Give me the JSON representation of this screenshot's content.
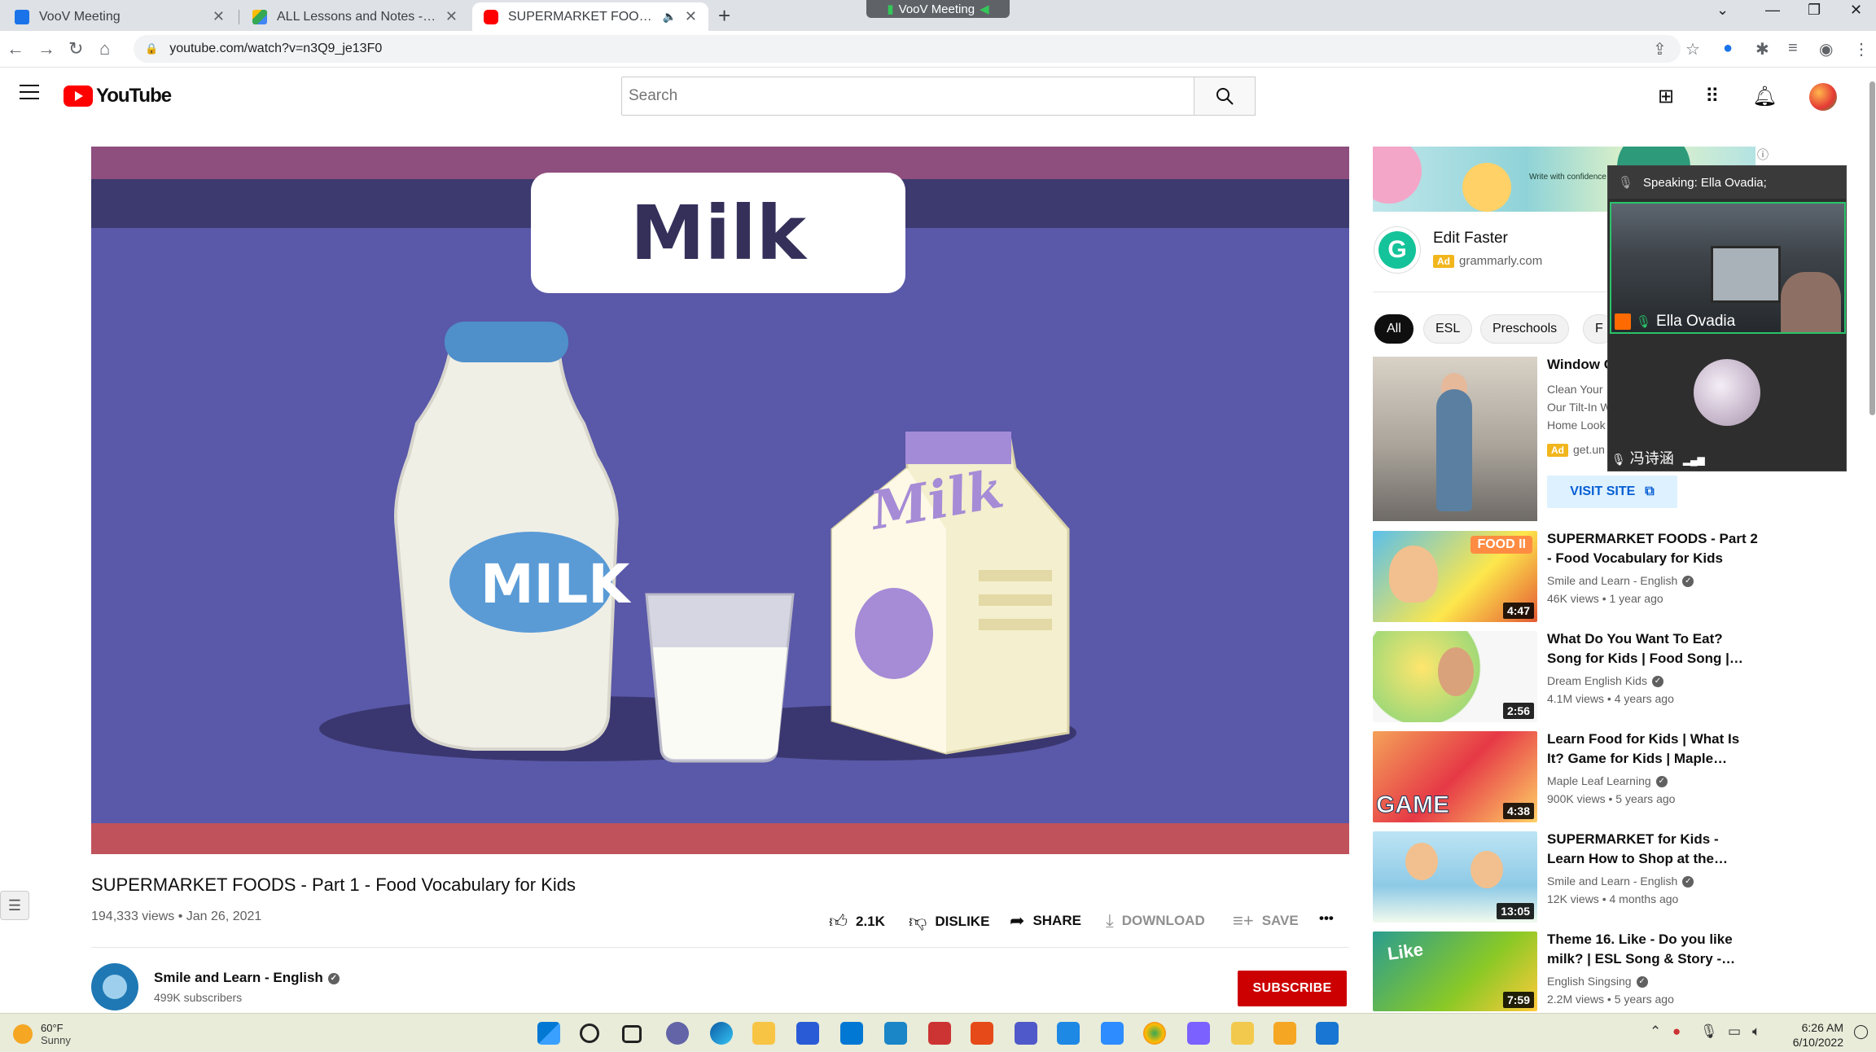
{
  "browser": {
    "tabs": [
      {
        "title": "VooV Meeting",
        "active": false
      },
      {
        "title": "ALL Lessons and Notes - Google",
        "active": false
      },
      {
        "title": "SUPERMARKET FOODS - Par",
        "active": true
      }
    ],
    "new_tab": "+",
    "meeting_pill": "VooV Meeting",
    "url": "youtube.com/watch?v=n3Q9_je13F0"
  },
  "youtube": {
    "logo_text": "YouTube",
    "search_placeholder": "Search"
  },
  "video": {
    "player_title_card": "Milk",
    "title": "SUPERMARKET FOODS - Part 1 - Food Vocabulary for Kids",
    "meta": "194,333 views • Jan 26, 2021",
    "actions": {
      "like_count": "2.1K",
      "dislike": "DISLIKE",
      "share": "SHARE",
      "download": "DOWNLOAD",
      "save": "SAVE",
      "more": "•••"
    },
    "channel": {
      "name": "Smile and Learn - English",
      "subscribers": "499K subscribers",
      "subscribe_label": "SUBSCRIBE"
    }
  },
  "sidebar": {
    "ad": {
      "banner_caption": "Write with confidence",
      "title": "Edit Faster",
      "badge": "Ad",
      "domain": "grammarly.com",
      "icon_letter": "G"
    },
    "chips": [
      "All",
      "ESL",
      "Preschools",
      "F"
    ],
    "promoted": {
      "title": "Window C",
      "lines": [
        "Clean Your",
        "Our Tilt-In W",
        "Home Look"
      ],
      "badge": "Ad",
      "domain": "get.un",
      "visit": "VISIT SITE"
    },
    "videos": [
      {
        "title": "SUPERMARKET FOODS - Part 2 - Food Vocabulary for Kids",
        "channel": "Smile and Learn - English",
        "meta": "46K views • 1 year ago",
        "duration": "4:47",
        "thumb_tag": "FOOD II"
      },
      {
        "title": "What Do You Want To Eat? Song for Kids | Food Song | Learn…",
        "channel": "Dream English Kids",
        "meta": "4.1M views • 4 years ago",
        "duration": "2:56"
      },
      {
        "title": "Learn Food for Kids | What Is It? Game for Kids | Maple Leaf…",
        "channel": "Maple Leaf Learning",
        "meta": "900K views • 5 years ago",
        "duration": "4:38",
        "thumb_tag": "GAME"
      },
      {
        "title": "SUPERMARKET for Kids - Learn How to Shop at the…",
        "channel": "Smile and Learn - English",
        "meta": "12K views • 4 months ago",
        "duration": "13:05"
      },
      {
        "title": "Theme 16. Like - Do you like milk? | ESL Song & Story -…",
        "channel": "English Singsing",
        "meta": "2.2M views • 5 years ago",
        "duration": "7:59",
        "thumb_tag": "Like"
      }
    ]
  },
  "voov": {
    "speaking": "Speaking: Ella Ovadia;",
    "participant1": "Ella Ovadia",
    "participant2": "冯诗涵"
  },
  "taskbar": {
    "temp": "60°F",
    "condition": "Sunny",
    "time": "6:26 AM",
    "date": "6/10/2022"
  }
}
